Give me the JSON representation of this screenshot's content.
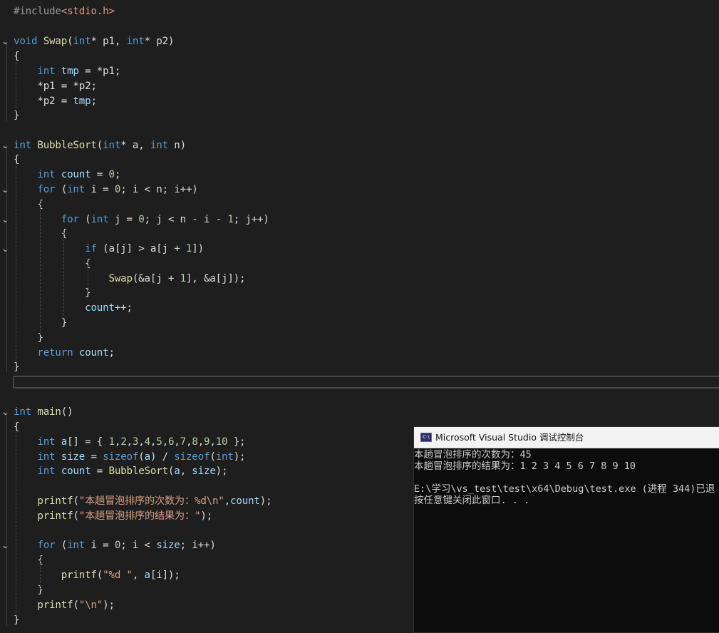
{
  "editor": {
    "lines": [
      {
        "fold": "",
        "tokens": [
          [
            "pp",
            "#include"
          ],
          [
            "hdr",
            "<stdio.h>"
          ]
        ]
      },
      {
        "fold": "",
        "tokens": []
      },
      {
        "fold": "v",
        "tokens": [
          [
            "kw",
            "void"
          ],
          [
            "plain",
            " "
          ],
          [
            "fn",
            "Swap"
          ],
          [
            "plain",
            "("
          ],
          [
            "kw",
            "int"
          ],
          [
            "plain",
            "* p1, "
          ],
          [
            "kw",
            "int"
          ],
          [
            "plain",
            "* p2)"
          ]
        ]
      },
      {
        "fold": "",
        "tokens": [
          [
            "plain",
            "{"
          ]
        ]
      },
      {
        "fold": "",
        "tokens": [
          [
            "plain",
            "    "
          ],
          [
            "kw",
            "int"
          ],
          [
            "plain",
            " "
          ],
          [
            "lv",
            "tmp"
          ],
          [
            "plain",
            " = *p1;"
          ]
        ]
      },
      {
        "fold": "",
        "tokens": [
          [
            "plain",
            "    *p1 = *p2;"
          ]
        ]
      },
      {
        "fold": "",
        "tokens": [
          [
            "plain",
            "    *p2 = "
          ],
          [
            "lv",
            "tmp"
          ],
          [
            "plain",
            ";"
          ]
        ]
      },
      {
        "fold": "",
        "tokens": [
          [
            "plain",
            "}"
          ]
        ]
      },
      {
        "fold": "",
        "tokens": []
      },
      {
        "fold": "v",
        "tokens": [
          [
            "kw",
            "int"
          ],
          [
            "plain",
            " "
          ],
          [
            "fn",
            "BubbleSort"
          ],
          [
            "plain",
            "("
          ],
          [
            "kw",
            "int"
          ],
          [
            "plain",
            "* a, "
          ],
          [
            "kw",
            "int"
          ],
          [
            "plain",
            " n)"
          ]
        ]
      },
      {
        "fold": "",
        "tokens": [
          [
            "plain",
            "{"
          ]
        ]
      },
      {
        "fold": "",
        "tokens": [
          [
            "plain",
            "    "
          ],
          [
            "kw",
            "int"
          ],
          [
            "plain",
            " "
          ],
          [
            "lv",
            "count"
          ],
          [
            "plain",
            " = "
          ],
          [
            "num",
            "0"
          ],
          [
            "plain",
            ";"
          ]
        ]
      },
      {
        "fold": "v",
        "tokens": [
          [
            "plain",
            "    "
          ],
          [
            "kw",
            "for"
          ],
          [
            "plain",
            " ("
          ],
          [
            "kw",
            "int"
          ],
          [
            "plain",
            " i = "
          ],
          [
            "num",
            "0"
          ],
          [
            "plain",
            "; i < n; i++)"
          ]
        ]
      },
      {
        "fold": "",
        "tokens": [
          [
            "plain",
            "    {"
          ]
        ]
      },
      {
        "fold": "v",
        "tokens": [
          [
            "plain",
            "        "
          ],
          [
            "kw",
            "for"
          ],
          [
            "plain",
            " ("
          ],
          [
            "kw",
            "int"
          ],
          [
            "plain",
            " j = "
          ],
          [
            "num",
            "0"
          ],
          [
            "plain",
            "; j < n - i - "
          ],
          [
            "num",
            "1"
          ],
          [
            "plain",
            "; j++)"
          ]
        ]
      },
      {
        "fold": "",
        "tokens": [
          [
            "plain",
            "        {"
          ]
        ]
      },
      {
        "fold": "v",
        "tokens": [
          [
            "plain",
            "            "
          ],
          [
            "kw",
            "if"
          ],
          [
            "plain",
            " (a[j] > a[j + "
          ],
          [
            "num",
            "1"
          ],
          [
            "plain",
            "])"
          ]
        ]
      },
      {
        "fold": "",
        "tokens": [
          [
            "plain",
            "            {"
          ]
        ]
      },
      {
        "fold": "",
        "tokens": [
          [
            "plain",
            "                "
          ],
          [
            "fn",
            "Swap"
          ],
          [
            "plain",
            "(&a[j + "
          ],
          [
            "num",
            "1"
          ],
          [
            "plain",
            "], &a[j]);"
          ]
        ]
      },
      {
        "fold": "",
        "tokens": [
          [
            "plain",
            "            }"
          ]
        ]
      },
      {
        "fold": "",
        "tokens": [
          [
            "plain",
            "            "
          ],
          [
            "lv",
            "count"
          ],
          [
            "plain",
            "++;"
          ]
        ]
      },
      {
        "fold": "",
        "tokens": [
          [
            "plain",
            "        }"
          ]
        ]
      },
      {
        "fold": "",
        "tokens": [
          [
            "plain",
            "    }"
          ]
        ]
      },
      {
        "fold": "",
        "tokens": [
          [
            "plain",
            "    "
          ],
          [
            "kw",
            "return"
          ],
          [
            "plain",
            " "
          ],
          [
            "lv",
            "count"
          ],
          [
            "plain",
            ";"
          ]
        ]
      },
      {
        "fold": "",
        "tokens": [
          [
            "plain",
            "}"
          ]
        ]
      },
      {
        "fold": "",
        "tokens": []
      },
      {
        "fold": "",
        "tokens": []
      },
      {
        "fold": "v",
        "tokens": [
          [
            "kw",
            "int"
          ],
          [
            "plain",
            " "
          ],
          [
            "fn",
            "main"
          ],
          [
            "plain",
            "()"
          ]
        ]
      },
      {
        "fold": "",
        "tokens": [
          [
            "plain",
            "{"
          ]
        ]
      },
      {
        "fold": "",
        "tokens": [
          [
            "plain",
            "    "
          ],
          [
            "kw",
            "int"
          ],
          [
            "plain",
            " "
          ],
          [
            "lv",
            "a"
          ],
          [
            "plain",
            "[] = { "
          ],
          [
            "num",
            "1"
          ],
          [
            "plain",
            ","
          ],
          [
            "num",
            "2"
          ],
          [
            "plain",
            ","
          ],
          [
            "num",
            "3"
          ],
          [
            "plain",
            ","
          ],
          [
            "num",
            "4"
          ],
          [
            "plain",
            ","
          ],
          [
            "num",
            "5"
          ],
          [
            "plain",
            ","
          ],
          [
            "num",
            "6"
          ],
          [
            "plain",
            ","
          ],
          [
            "num",
            "7"
          ],
          [
            "plain",
            ","
          ],
          [
            "num",
            "8"
          ],
          [
            "plain",
            ","
          ],
          [
            "num",
            "9"
          ],
          [
            "plain",
            ","
          ],
          [
            "num",
            "10"
          ],
          [
            "plain",
            " };"
          ]
        ]
      },
      {
        "fold": "",
        "tokens": [
          [
            "plain",
            "    "
          ],
          [
            "kw",
            "int"
          ],
          [
            "plain",
            " "
          ],
          [
            "lv",
            "size"
          ],
          [
            "plain",
            " = "
          ],
          [
            "kw",
            "sizeof"
          ],
          [
            "plain",
            "("
          ],
          [
            "lv",
            "a"
          ],
          [
            "plain",
            ") / "
          ],
          [
            "kw",
            "sizeof"
          ],
          [
            "plain",
            "("
          ],
          [
            "kw",
            "int"
          ],
          [
            "plain",
            ");"
          ]
        ]
      },
      {
        "fold": "",
        "tokens": [
          [
            "plain",
            "    "
          ],
          [
            "kw",
            "int"
          ],
          [
            "plain",
            " "
          ],
          [
            "lv",
            "count"
          ],
          [
            "plain",
            " = "
          ],
          [
            "fn",
            "BubbleSort"
          ],
          [
            "plain",
            "("
          ],
          [
            "lv",
            "a"
          ],
          [
            "plain",
            ", "
          ],
          [
            "lv",
            "size"
          ],
          [
            "plain",
            ");"
          ]
        ]
      },
      {
        "fold": "",
        "tokens": []
      },
      {
        "fold": "",
        "tokens": [
          [
            "plain",
            "    "
          ],
          [
            "fn",
            "printf"
          ],
          [
            "plain",
            "("
          ],
          [
            "str",
            "\"本趟冒泡排序的次数为：%d\\n\""
          ],
          [
            "plain",
            ","
          ],
          [
            "lv",
            "count"
          ],
          [
            "plain",
            ");"
          ]
        ]
      },
      {
        "fold": "",
        "tokens": [
          [
            "plain",
            "    "
          ],
          [
            "fn",
            "printf"
          ],
          [
            "plain",
            "("
          ],
          [
            "str",
            "\"本趟冒泡排序的结果为：\""
          ],
          [
            "plain",
            ");"
          ]
        ]
      },
      {
        "fold": "",
        "tokens": []
      },
      {
        "fold": "v",
        "tokens": [
          [
            "plain",
            "    "
          ],
          [
            "kw",
            "for"
          ],
          [
            "plain",
            " ("
          ],
          [
            "kw",
            "int"
          ],
          [
            "plain",
            " i = "
          ],
          [
            "num",
            "0"
          ],
          [
            "plain",
            "; i < "
          ],
          [
            "lv",
            "size"
          ],
          [
            "plain",
            "; i++)"
          ]
        ]
      },
      {
        "fold": "",
        "tokens": [
          [
            "plain",
            "    {"
          ]
        ]
      },
      {
        "fold": "",
        "tokens": [
          [
            "plain",
            "        "
          ],
          [
            "fn",
            "printf"
          ],
          [
            "plain",
            "("
          ],
          [
            "str",
            "\"%d \""
          ],
          [
            "plain",
            ", "
          ],
          [
            "lv",
            "a"
          ],
          [
            "plain",
            "[i]);"
          ]
        ]
      },
      {
        "fold": "",
        "tokens": [
          [
            "plain",
            "    }"
          ]
        ]
      },
      {
        "fold": "",
        "tokens": [
          [
            "plain",
            "    "
          ],
          [
            "fn",
            "printf"
          ],
          [
            "plain",
            "("
          ],
          [
            "str",
            "\"\\n\""
          ],
          [
            "plain",
            ");"
          ]
        ]
      },
      {
        "fold": "",
        "tokens": [
          [
            "plain",
            "}"
          ]
        ]
      }
    ]
  },
  "console": {
    "title": "Microsoft Visual Studio 调试控制台",
    "icon": "console-app-icon",
    "output": [
      "本趟冒泡排序的次数为：45",
      "本趟冒泡排序的结果为：1 2 3 4 5 6 7 8 9 10",
      "",
      "E:\\学习\\vs_test\\test\\x64\\Debug\\test.exe (进程 344)已退",
      "按任意键关闭此窗口. . ."
    ]
  }
}
